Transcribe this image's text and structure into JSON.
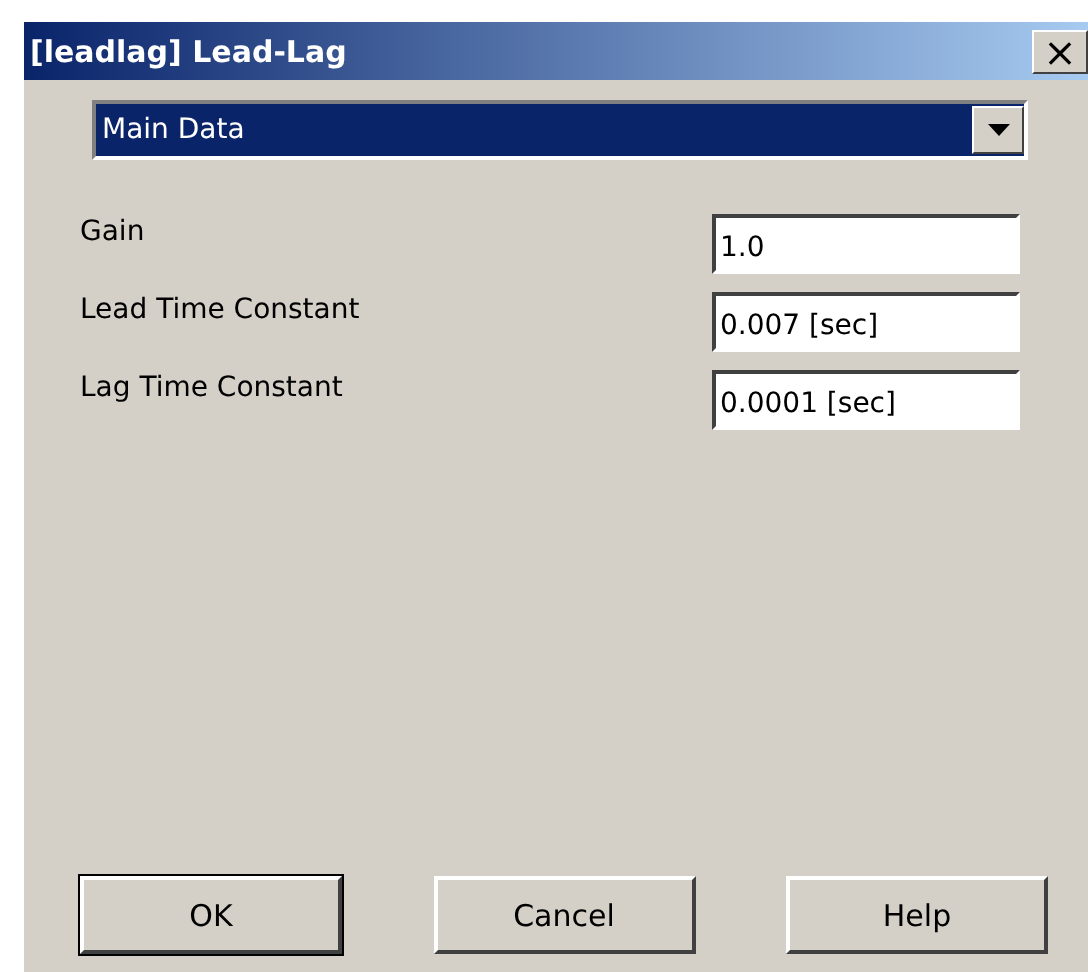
{
  "window": {
    "title": "[leadlag] Lead-Lag",
    "close": "×"
  },
  "page_selector": {
    "value": "Main Data"
  },
  "parameters": [
    {
      "label": "Gain",
      "value": "1.0"
    },
    {
      "label": "Lead Time Constant",
      "value": "0.007 [sec]"
    },
    {
      "label": "Lag Time Constant",
      "value": "0.0001 [sec]"
    }
  ],
  "buttons": [
    {
      "label": "OK",
      "default": true
    },
    {
      "label": "Cancel",
      "default": false
    },
    {
      "label": "Help",
      "default": false
    }
  ]
}
